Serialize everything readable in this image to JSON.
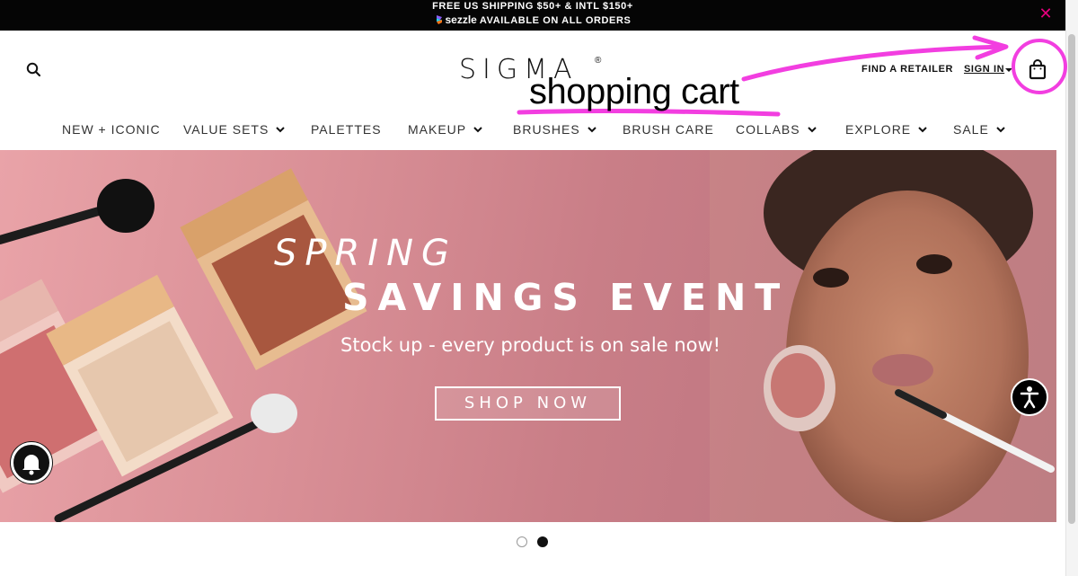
{
  "promo": {
    "line1": "FREE US SHIPPING $50+ & INTL $150+",
    "sezzle_brand": "sezzle",
    "line2": "AVAILABLE ON ALL ORDERS",
    "close_glyph": "✕"
  },
  "header": {
    "logo_text": "SIGMA",
    "logo_reg": "®",
    "find_retailer": "FIND A RETAILER",
    "sign_in": "SIGN IN",
    "icons": [
      "search-icon",
      "shopping-bag-icon",
      "chevron-down-icon"
    ]
  },
  "annotation": {
    "label": "shopping cart",
    "color": "#f23ee0"
  },
  "nav": {
    "items": [
      {
        "label": "NEW + ICONIC",
        "has_dropdown": false
      },
      {
        "label": "VALUE SETS",
        "has_dropdown": true
      },
      {
        "label": "PALETTES",
        "has_dropdown": false
      },
      {
        "label": "MAKEUP",
        "has_dropdown": true
      },
      {
        "label": "BRUSHES",
        "has_dropdown": true
      },
      {
        "label": "BRUSH CARE",
        "has_dropdown": false
      },
      {
        "label": "COLLABS",
        "has_dropdown": true
      },
      {
        "label": "EXPLORE",
        "has_dropdown": true
      },
      {
        "label": "SALE",
        "has_dropdown": true
      }
    ]
  },
  "hero": {
    "eyebrow": "SPRING",
    "title": "SAVINGS EVENT",
    "subtitle": "Stock up - every product is on sale now!",
    "cta": "SHOP NOW",
    "compact_brand": "SIGMA",
    "background_color": "#d98f96"
  },
  "carousel": {
    "slide_count": 2,
    "active_slide": 2
  },
  "widgets": {
    "accessibility_icon": "accessibility-icon",
    "notification_icon": "bell-icon"
  },
  "colors": {
    "promo_bar": "#050505",
    "close_accent": "#e6007e",
    "text_dark": "#111111"
  }
}
